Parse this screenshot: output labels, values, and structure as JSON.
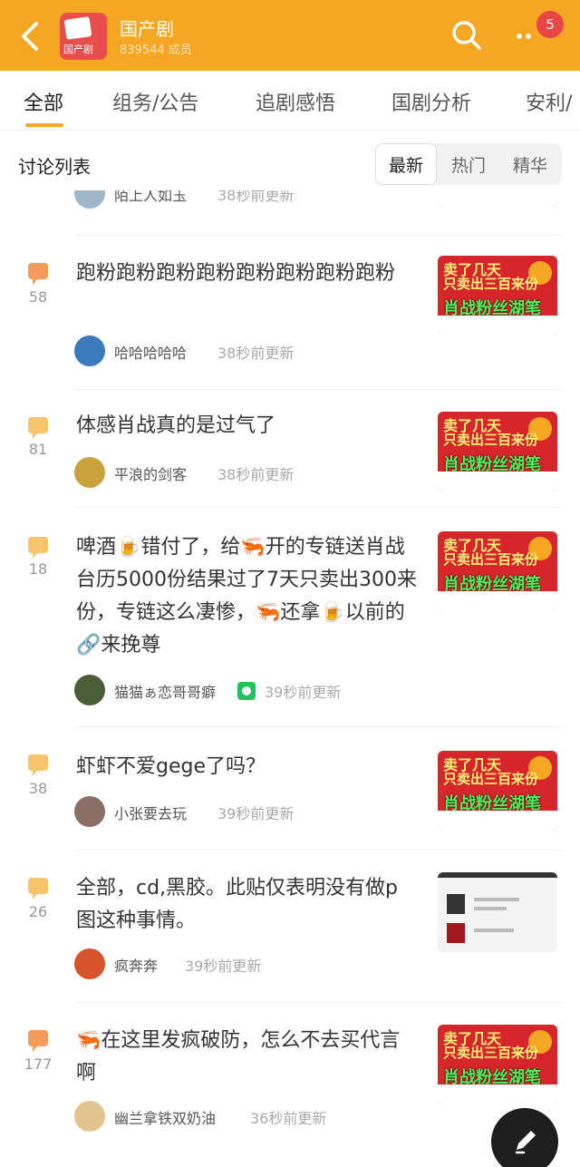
{
  "header": {
    "group_name": "国产剧",
    "members": "839544 成员",
    "badge_count": "5",
    "icons": [
      "back-icon",
      "search-icon",
      "more-icon"
    ]
  },
  "tabs": [
    "全部",
    "组务/公告",
    "追剧感悟",
    "国剧分析",
    "安利/"
  ],
  "list": {
    "title": "讨论列表",
    "sort": [
      "最新",
      "热门",
      "精华"
    ]
  },
  "partial_top": {
    "user": "陌上人如玉",
    "updated": "38秒前更新"
  },
  "posts": [
    {
      "count": "58",
      "title": "跑粉跑粉跑粉跑粉跑粉跑粉跑粉跑粉",
      "user": "哈哈哈哈哈",
      "updated": "38秒前更新"
    },
    {
      "count": "81",
      "title": "体感肖战真的是过气了",
      "user": "平浪的剑客",
      "updated": "38秒前更新"
    },
    {
      "count": "18",
      "title": "啤酒🍺错付了，给🦐开的专链送肖战台历5000份结果过了7天只卖出300来份，专链这么凄惨，🦐还拿🍺以前的🔗来挽尊",
      "user": "猫猫ぁ恋哥哥癖",
      "updated": "39秒前更新"
    },
    {
      "count": "38",
      "title": "虾虾不爱gege了吗？",
      "user": "小张要去玩",
      "updated": "39秒前更新"
    },
    {
      "count": "26",
      "title": "全部，cd,黑胶。此贴仅表明没有做p图这种事情。",
      "user": "疯奔奔",
      "updated": "39秒前更新"
    },
    {
      "count": "177",
      "title": "🦐在这里发疯破防，怎么不去买代言啊",
      "user": "幽兰拿铁双奶油",
      "updated": "36秒前更新"
    }
  ],
  "thumbnail_text": {
    "line1": "卖了几天",
    "line2": "只卖出三百来份",
    "line3": "肖战粉丝湖笔"
  }
}
